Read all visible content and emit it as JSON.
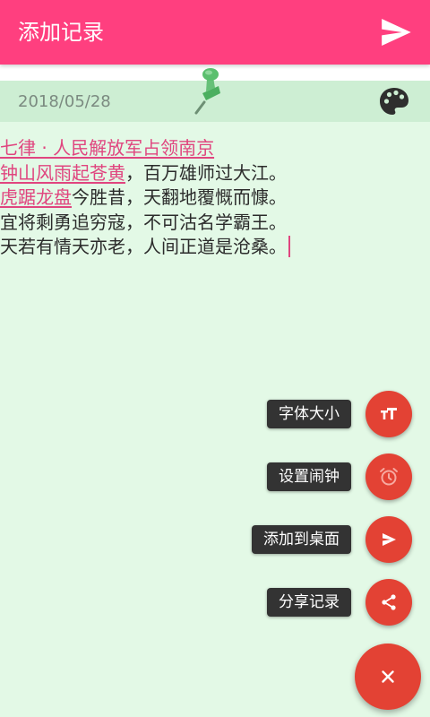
{
  "header": {
    "title": "添加记录",
    "send_icon": "send-icon",
    "background": "#ff3f7f"
  },
  "note": {
    "date": "2018/05/28",
    "palette_icon": "palette-icon",
    "pin_icon": "pushpin-icon",
    "background": "#e3f9e6",
    "lines": {
      "0": {
        "a": "七律 · 人民解放军占领南京"
      },
      "1": {
        "a": "钟山风雨起苍黄",
        "b": "，百万雄师过大江。"
      },
      "2": {
        "a": "虎踞龙盘",
        "b": "今胜昔，天翻地覆慨而慷。"
      },
      "3": {
        "a": "宜将剩勇追穷寇，不可沽名学霸王。"
      },
      "4": {
        "a": "天若有情天亦老，人间正道是沧桑。"
      }
    }
  },
  "fab_menu": {
    "accent": "#e34234",
    "items": [
      {
        "label": "字体大小",
        "icon": "text-size-icon"
      },
      {
        "label": "设置闹钟",
        "icon": "alarm-clock-icon"
      },
      {
        "label": "添加到桌面",
        "icon": "send-icon"
      },
      {
        "label": "分享记录",
        "icon": "share-icon"
      }
    ],
    "close_icon": "close-icon"
  }
}
